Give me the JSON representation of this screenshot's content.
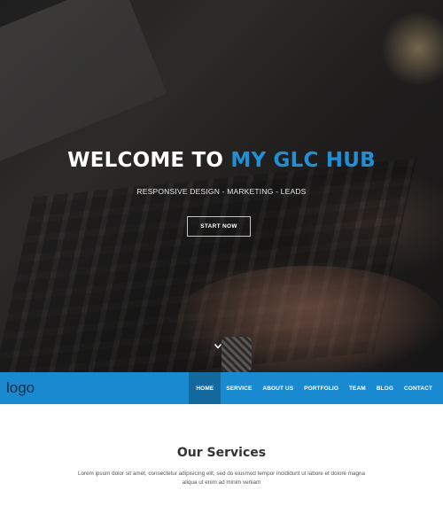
{
  "hero": {
    "title_prefix": "WELCOME TO",
    "title_accent": "MY GLC HUB",
    "subtitle": "RESPONSIVE DESIGN - MARKETING - LEADS",
    "cta_label": "START NOW",
    "scroll_icon": "chevron-down-icon"
  },
  "navbar": {
    "logo": "logo",
    "items": [
      {
        "label": "HOME",
        "active": true
      },
      {
        "label": "SERVICE"
      },
      {
        "label": "ABOUT US"
      },
      {
        "label": "PORTFOLIO"
      },
      {
        "label": "TEAM"
      },
      {
        "label": "BLOG"
      },
      {
        "label": "CONTACT"
      }
    ]
  },
  "services": {
    "title": "Our Services",
    "description": "Lorem ipsum dolor sit amet, consectetur adipisicing elit, sed do eiusmod tempor incididunt ut labore et dolore magna aliqua ut enim ad minim veniam"
  },
  "colors": {
    "accent": "#1f8fd6",
    "navbar_bg": "#1a8ad0",
    "nav_active_bg": "#14699e",
    "logo_text": "#0e2d44"
  }
}
